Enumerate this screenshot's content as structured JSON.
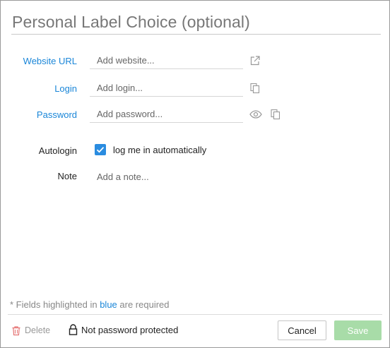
{
  "dialog": {
    "title_placeholder": "Personal Label Choice (optional)"
  },
  "fields": {
    "website": {
      "label": "Website URL",
      "placeholder": "Add website..."
    },
    "login": {
      "label": "Login",
      "placeholder": "Add login..."
    },
    "password": {
      "label": "Password",
      "placeholder": "Add password..."
    }
  },
  "autologin": {
    "label": "Autologin",
    "checkbox_label": "log me in automatically",
    "checked": true
  },
  "note": {
    "label": "Note",
    "placeholder": "Add a note..."
  },
  "required_hint": {
    "prefix": "* Fields highlighted in ",
    "highlight": "blue",
    "suffix": " are required"
  },
  "footer": {
    "delete_label": "Delete",
    "protection_status": "Not password protected",
    "cancel_label": "Cancel",
    "save_label": "Save"
  },
  "colors": {
    "required_label": "#1a86d8",
    "checkbox": "#2a8ce0",
    "save_disabled": "#a8dca8",
    "delete": "#e57373"
  },
  "icons": {
    "website_action": "external-link-icon",
    "login_action": "copy-icon",
    "password_reveal": "eye-icon",
    "password_action": "copy-icon",
    "delete": "trash-icon",
    "protection": "unlock-icon"
  }
}
